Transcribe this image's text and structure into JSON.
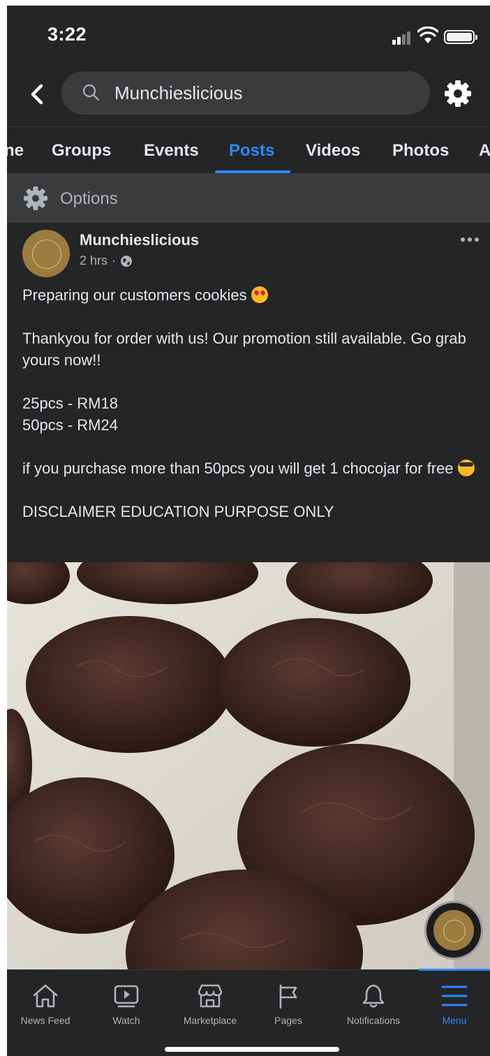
{
  "status_bar": {
    "time": "3:22"
  },
  "search": {
    "query": "Munchieslicious"
  },
  "tabs": [
    {
      "label": "ne"
    },
    {
      "label": "Groups"
    },
    {
      "label": "Events"
    },
    {
      "label": "Posts",
      "active": true
    },
    {
      "label": "Videos"
    },
    {
      "label": "Photos"
    },
    {
      "label": "A"
    }
  ],
  "options": {
    "label": "Options"
  },
  "post": {
    "author": "Munchieslicious",
    "time": "2 hrs",
    "separator": "·",
    "text": {
      "line1": "Preparing our customers cookies",
      "line2": "Thankyou for order with us! Our promotion still available. Go grab yours now!!",
      "price1": "25pcs - RM18",
      "price2": "50pcs - RM24",
      "line4": "if you purchase more than 50pcs you will get 1 chocojar for free",
      "disclaimer": "DISCLAIMER EDUCATION PURPOSE ONLY"
    }
  },
  "bottom_nav": [
    {
      "label": "News Feed",
      "icon": "home-icon"
    },
    {
      "label": "Watch",
      "icon": "watch-icon"
    },
    {
      "label": "Marketplace",
      "icon": "marketplace-icon"
    },
    {
      "label": "Pages",
      "icon": "flag-icon"
    },
    {
      "label": "Notifications",
      "icon": "bell-icon"
    },
    {
      "label": "Menu",
      "icon": "menu-icon",
      "active": true
    }
  ],
  "colors": {
    "background": "#242526",
    "accent": "#2d88ff",
    "secondary_text": "#b0b3b8",
    "surface": "#3a3b3c"
  }
}
